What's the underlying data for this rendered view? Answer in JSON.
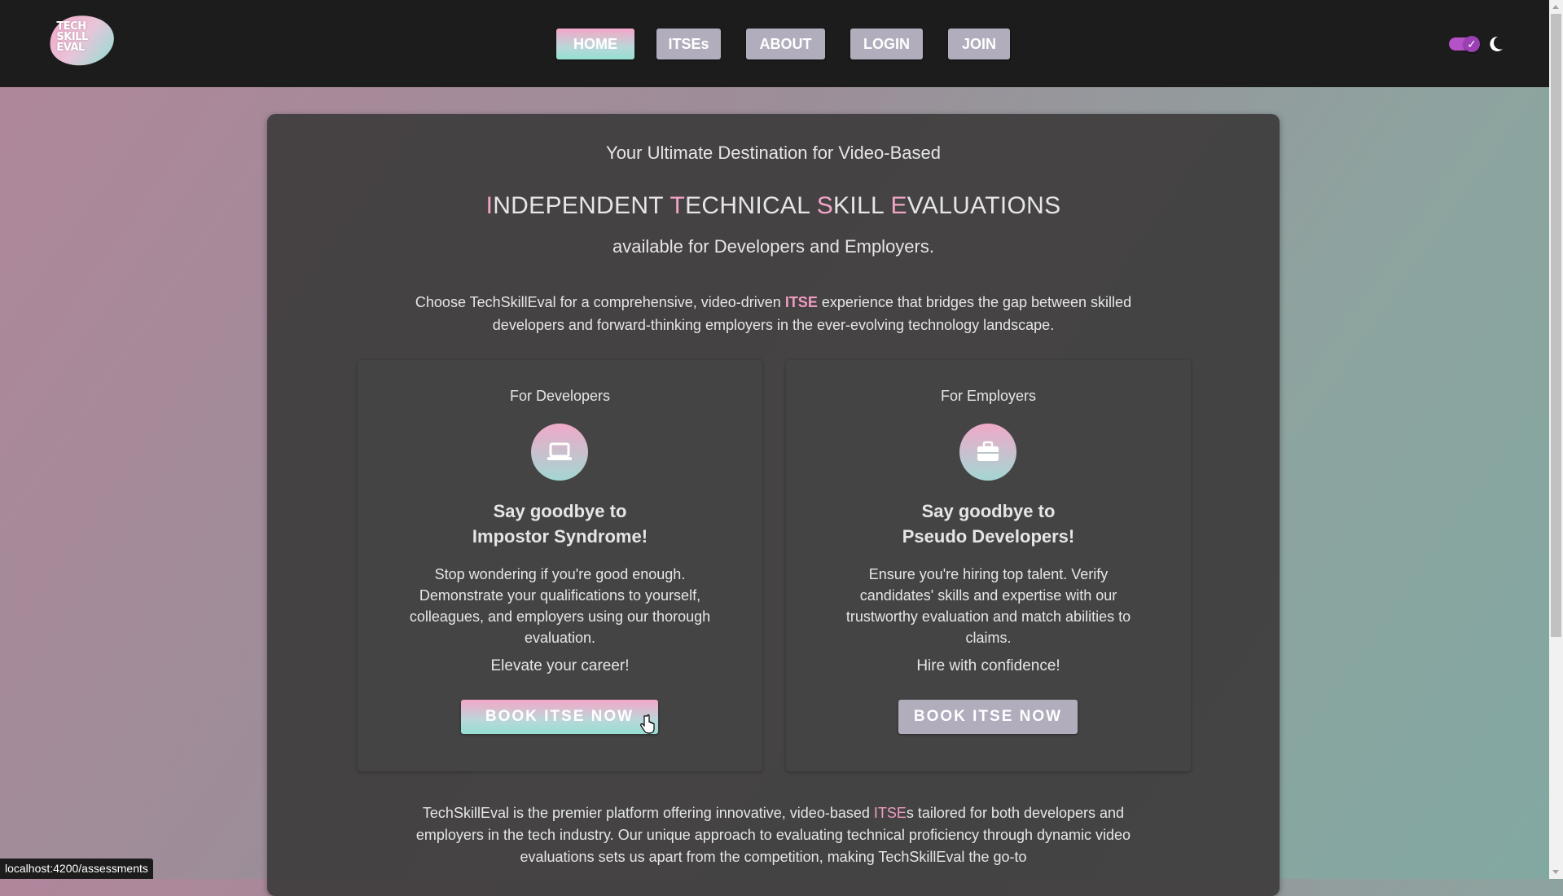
{
  "logo": {
    "text": "TECH SKILL EVAL"
  },
  "nav": {
    "items": [
      {
        "label": "HOME"
      },
      {
        "label": "ITSEs"
      },
      {
        "label": "ABOUT"
      },
      {
        "label": "LOGIN"
      },
      {
        "label": "JOIN"
      }
    ],
    "active": "HOME"
  },
  "theme": {
    "dark_mode": true,
    "toggle_icon": "check-icon",
    "mode_icon": "moon-icon"
  },
  "hero": {
    "tagline": "Your Ultimate Destination for Video-Based",
    "headline": {
      "i": "I",
      "ndependent": "NDEPENDENT ",
      "t": "T",
      "echnical": "ECHNICAL ",
      "s": "S",
      "kill": "KILL ",
      "e": "E",
      "valuations": "VALUATIONS"
    },
    "subline": "available for Developers and Employers.",
    "intro_before": "Choose TechSkillEval for a comprehensive, video-driven ",
    "intro_highlight": "ITSE",
    "intro_after": " experience that bridges the gap between skilled developers and forward-thinking employers in the ever-evolving technology landscape."
  },
  "cards": {
    "developers": {
      "label": "For Developers",
      "icon": "laptop-icon",
      "title_line1": "Say goodbye to",
      "title_line2": "Impostor Syndrome!",
      "description": "Stop wondering if you're good enough. Demonstrate your qualifications to yourself, colleagues, and employers using our thorough evaluation.",
      "cta": "Elevate your career!",
      "button": "BOOK ITSE NOW"
    },
    "employers": {
      "label": "For Employers",
      "icon": "briefcase-icon",
      "title_line1": "Say goodbye to",
      "title_line2": "Pseudo Developers!",
      "description": "Ensure you're hiring top talent. Verify candidates' skills and expertise with our trustworthy evaluation and match abilities to claims.",
      "cta": "Hire with confidence!",
      "button": "BOOK ITSE NOW"
    }
  },
  "outro": {
    "before": "TechSkillEval is the premier platform offering innovative, video-based ",
    "highlight": "ITSE",
    "after": "s tailored for both developers and employers in the tech industry. Our unique approach to evaluating technical proficiency through dynamic video evaluations sets us apart from the competition, making TechSkillEval the go-to"
  },
  "status": {
    "url": "localhost:4200/assessments"
  },
  "colors": {
    "accent_pink": "#f2a4c7",
    "accent_teal": "#95dfd1",
    "toggle_purple": "#b552c7"
  }
}
